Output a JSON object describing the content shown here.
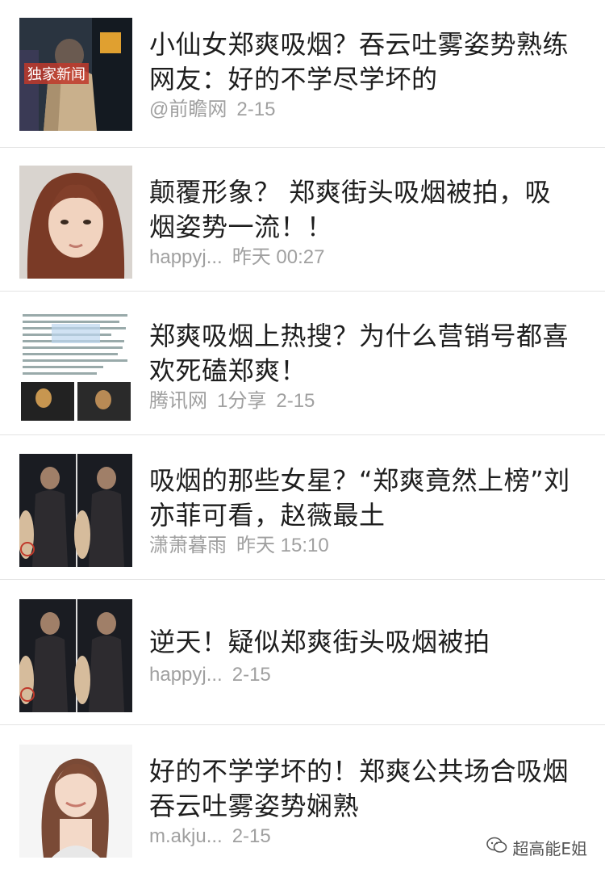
{
  "items": [
    {
      "title": "小仙女郑爽吸烟？吞云吐雾姿势熟练网友：好的不学尽学坏的",
      "source": "@前瞻网",
      "time": "2-15",
      "thumb_icon": "news-video-thumbnail",
      "thumb_text": "独家新闻"
    },
    {
      "title": "颠覆形象？ 郑爽街头吸烟被拍，吸烟姿势一流！！",
      "source": "happyj...",
      "time": "昨天 00:27",
      "thumb_icon": "portrait-thumbnail"
    },
    {
      "title": "郑爽吸烟上热搜？为什么营销号都喜欢死磕郑爽！",
      "source": "腾讯网",
      "share": "1分享",
      "time": "2-15",
      "thumb_icon": "screenshot-collage-thumbnail"
    },
    {
      "title": "吸烟的那些女星？“郑爽竟然上榜”刘亦菲可看，赵薇最土",
      "source": "潇萧暮雨",
      "time": "昨天 15:10",
      "thumb_icon": "street-photo-thumbnail"
    },
    {
      "title": "逆天！疑似郑爽街头吸烟被拍",
      "source": "happyj...",
      "time": "2-15",
      "thumb_icon": "street-photo-thumbnail"
    },
    {
      "title": "好的不学学坏的！郑爽公共场合吸烟吞云吐雾姿势娴熟",
      "source": "m.akju...",
      "time": "2-15",
      "thumb_icon": "portrait-thumbnail"
    }
  ],
  "watermark": {
    "text": "超高能E姐",
    "icon": "wechat-icon"
  }
}
